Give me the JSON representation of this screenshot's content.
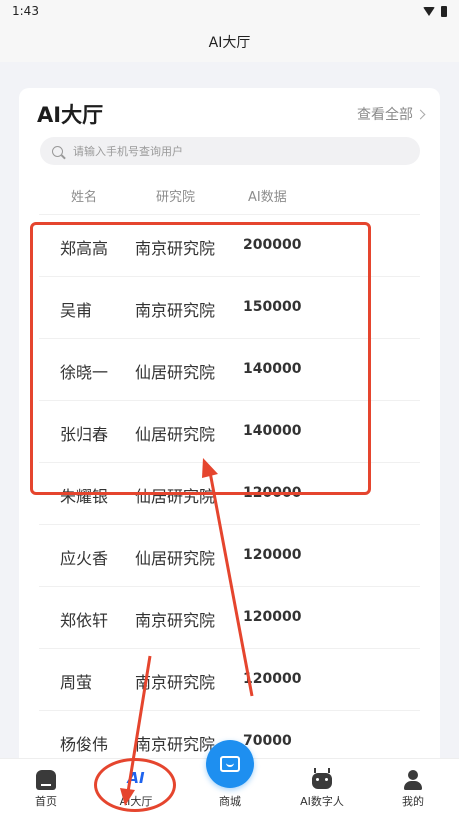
{
  "status_bar": {
    "time": "1:43"
  },
  "title_bar": {
    "title": "AI大厅"
  },
  "card": {
    "title": "AI大厅",
    "view_all": "查看全部",
    "search_placeholder": "请输入手机号查询用户",
    "columns": [
      "姓名",
      "研究院",
      "AI数据"
    ],
    "rows": [
      {
        "name": "郑高高",
        "institute": "南京研究院",
        "value": "200000"
      },
      {
        "name": "吴甫",
        "institute": "南京研究院",
        "value": "150000"
      },
      {
        "name": "徐晓一",
        "institute": "仙居研究院",
        "value": "140000"
      },
      {
        "name": "张归春",
        "institute": "仙居研究院",
        "value": "140000"
      },
      {
        "name": "朱耀银",
        "institute": "仙居研究院",
        "value": "120000"
      },
      {
        "name": "应火香",
        "institute": "仙居研究院",
        "value": "120000"
      },
      {
        "name": "郑依轩",
        "institute": "南京研究院",
        "value": "120000"
      },
      {
        "name": "周萤",
        "institute": "南京研究院",
        "value": "120000"
      },
      {
        "name": "杨俊伟",
        "institute": "南京研究院",
        "value": "70000"
      }
    ]
  },
  "bottom_nav": {
    "items": [
      {
        "label": "首页",
        "icon": "home-icon"
      },
      {
        "label": "AI大厅",
        "icon": "ai-icon",
        "icon_text": "AI"
      },
      {
        "label": "商城",
        "icon": "shopping-bag-icon"
      },
      {
        "label": "AI数字人",
        "icon": "robot-icon"
      },
      {
        "label": "我的",
        "icon": "user-icon"
      }
    ]
  },
  "colors": {
    "accent": "#1e63ee",
    "center_button": "#1e8ff0",
    "annotation": "#e5452e"
  }
}
